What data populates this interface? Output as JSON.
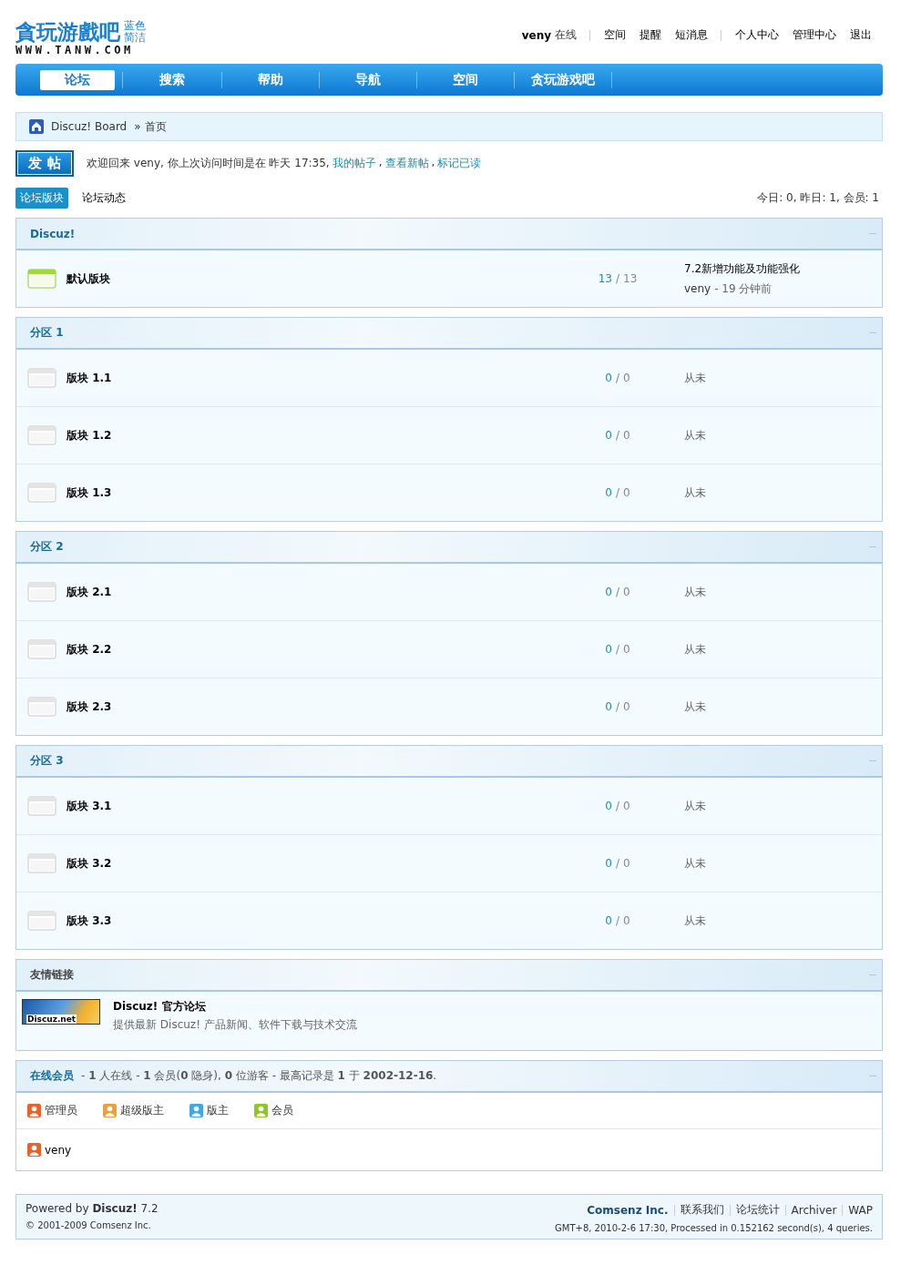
{
  "header": {
    "logo": {
      "title": "貪玩游戲吧",
      "tag_lines": [
        "蓝色",
        "简洁"
      ],
      "domain": "WWW.TANW.COM"
    },
    "user_bar": {
      "username": "veny",
      "status": "在线",
      "groups": [
        [
          "空间",
          "提醒",
          "短消息"
        ],
        [
          "个人中心",
          "管理中心",
          "退出"
        ]
      ]
    }
  },
  "nav": [
    {
      "label": "论坛",
      "selected": true
    },
    {
      "label": "搜索",
      "selected": false
    },
    {
      "label": "帮助",
      "selected": false
    },
    {
      "label": "导航",
      "selected": false
    },
    {
      "label": "空间",
      "selected": false
    },
    {
      "label": "贪玩游戏吧",
      "selected": false
    }
  ],
  "breadcrumb": {
    "site": "Discuz! Board",
    "separator": "»",
    "current": "首页"
  },
  "post_button": "发 帖",
  "welcome": {
    "text": "欢迎回来 veny, 你上次访问时间是在 昨天 17:35,",
    "links": [
      "我的帖子",
      "查看新帖",
      "标记已读"
    ],
    "link_separator": ","
  },
  "count_separator": "/",
  "view_tabs": [
    {
      "label": "论坛版块",
      "selected": true
    },
    {
      "label": "论坛动态",
      "selected": false
    }
  ],
  "stats": "今日: 0, 昨日: 1, 会员: 1",
  "categories": [
    {
      "title": "Discuz!",
      "forums": [
        {
          "name": "默认版块",
          "has_new": true,
          "threads": "13",
          "posts": "13",
          "last_post": {
            "title": "7.2新增功能及功能强化",
            "author": "veny",
            "time": "- 19 分钟前"
          }
        }
      ]
    },
    {
      "title": "分区 1",
      "forums": [
        {
          "name": "版块 1.1",
          "has_new": false,
          "threads": "0",
          "posts": "0",
          "never": "从未"
        },
        {
          "name": "版块 1.2",
          "has_new": false,
          "threads": "0",
          "posts": "0",
          "never": "从未"
        },
        {
          "name": "版块 1.3",
          "has_new": false,
          "threads": "0",
          "posts": "0",
          "never": "从未"
        }
      ]
    },
    {
      "title": "分区 2",
      "forums": [
        {
          "name": "版块 2.1",
          "has_new": false,
          "threads": "0",
          "posts": "0",
          "never": "从未"
        },
        {
          "name": "版块 2.2",
          "has_new": false,
          "threads": "0",
          "posts": "0",
          "never": "从未"
        },
        {
          "name": "版块 2.3",
          "has_new": false,
          "threads": "0",
          "posts": "0",
          "never": "从未"
        }
      ]
    },
    {
      "title": "分区 3",
      "forums": [
        {
          "name": "版块 3.1",
          "has_new": false,
          "threads": "0",
          "posts": "0",
          "never": "从未"
        },
        {
          "name": "版块 3.2",
          "has_new": false,
          "threads": "0",
          "posts": "0",
          "never": "从未"
        },
        {
          "name": "版块 3.3",
          "has_new": false,
          "threads": "0",
          "posts": "0",
          "never": "从未"
        }
      ]
    }
  ],
  "friend_links": {
    "title": "友情链接",
    "items": [
      {
        "logo": "Discuz.net",
        "name": "Discuz! 官方论坛",
        "description": "提供最新 Discuz! 产品新闻、软件下载与技术交流"
      }
    ]
  },
  "online": {
    "title": "在线会员",
    "summary": "- **1** 人在线 - **1** 会员(**0** 隐身), **0** 位游客 - 最高记录是 **1** 于 **2002-12-16**.",
    "legend": [
      {
        "label": "管理员",
        "color": "#e8622a"
      },
      {
        "label": "超级版主",
        "color": "#f0a030"
      },
      {
        "label": "版主",
        "color": "#3fa8e0"
      },
      {
        "label": "会员",
        "color": "#8cc820"
      }
    ],
    "users": [
      {
        "name": "veny",
        "color": "#e8622a"
      }
    ]
  },
  "footer": {
    "powered": "Powered by **Discuz!** 7.2",
    "copyright": "© 2001-2009 Comsenz Inc.",
    "company": "Comsenz Inc.",
    "links": [
      "联系我们",
      "论坛统计",
      "Archiver",
      "WAP"
    ],
    "info": "GMT+8, 2010-2-6 17:30, Processed in 0.152162 second(s), 4 queries."
  }
}
